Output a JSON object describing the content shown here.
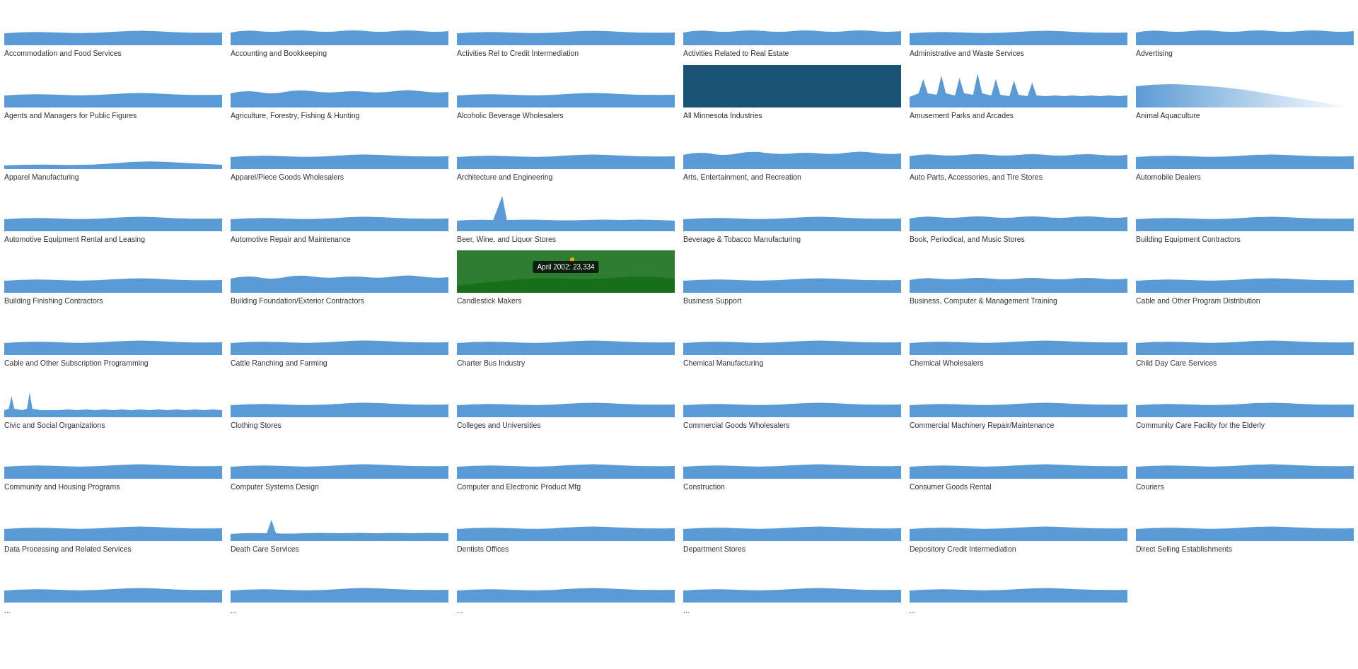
{
  "cells": [
    {
      "id": "c1",
      "label": "Accommodation and Food Services",
      "type": "wave_flat"
    },
    {
      "id": "c2",
      "label": "Accounting and Bookkeeping",
      "type": "wave_small"
    },
    {
      "id": "c3",
      "label": "Activities Rel to Credit Intermediation",
      "type": "wave_flat"
    },
    {
      "id": "c4",
      "label": "Activities Related to Real Estate",
      "type": "wave_small"
    },
    {
      "id": "c5",
      "label": "Administrative and Waste Services",
      "type": "wave_flat"
    },
    {
      "id": "c6",
      "label": "Advertising",
      "type": "wave_small"
    },
    {
      "id": "c7",
      "label": "Agents and Managers for Public Figures",
      "type": "wave_flat"
    },
    {
      "id": "c8",
      "label": "Agriculture, Forestry, Fishing & Hunting",
      "type": "wave_medium"
    },
    {
      "id": "c9",
      "label": "Alcoholic Beverage Wholesalers",
      "type": "wave_flat"
    },
    {
      "id": "c10",
      "label": "All Minnesota Industries",
      "type": "filled_dark"
    },
    {
      "id": "c11",
      "label": "Amusement Parks and Arcades",
      "type": "wave_spiky"
    },
    {
      "id": "c12",
      "label": "Animal Aquaculture",
      "type": "fade_right"
    },
    {
      "id": "c13",
      "label": "Apparel Manufacturing",
      "type": "wave_low"
    },
    {
      "id": "c14",
      "label": "Apparel/Piece Goods Wholesalers",
      "type": "wave_flat"
    },
    {
      "id": "c15",
      "label": "Architecture and Engineering",
      "type": "wave_flat"
    },
    {
      "id": "c16",
      "label": "Arts, Entertainment, and Recreation",
      "type": "wave_medium"
    },
    {
      "id": "c17",
      "label": "Auto Parts, Accessories, and Tire Stores",
      "type": "wave_small"
    },
    {
      "id": "c18",
      "label": "Automobile Dealers",
      "type": "wave_flat"
    },
    {
      "id": "c19",
      "label": "Automotive Equipment Rental and Leasing",
      "type": "wave_flat"
    },
    {
      "id": "c20",
      "label": "Automotive Repair and Maintenance",
      "type": "wave_flat"
    },
    {
      "id": "c21",
      "label": "Beer, Wine, and Liquor Stores",
      "type": "drop_spike",
      "highlighted": false
    },
    {
      "id": "c22",
      "label": "Beverage & Tobacco Manufacturing",
      "type": "wave_flat"
    },
    {
      "id": "c23",
      "label": "Book, Periodical, and Music Stores",
      "type": "wave_small"
    },
    {
      "id": "c24",
      "label": "Building Equipment Contractors",
      "type": "wave_flat"
    },
    {
      "id": "c25",
      "label": "Building Finishing Contractors",
      "type": "wave_flat"
    },
    {
      "id": "c26",
      "label": "Building Foundation/Exterior Contractors",
      "type": "wave_medium"
    },
    {
      "id": "c27",
      "label": "Candlestick Makers",
      "type": "green_highlighted",
      "tooltip": "April 2002: 23,334"
    },
    {
      "id": "c28",
      "label": "Business Support",
      "type": "wave_flat"
    },
    {
      "id": "c29",
      "label": "Business, Computer & Management Training",
      "type": "wave_small"
    },
    {
      "id": "c30",
      "label": "Cable and Other Program Distribution",
      "type": "wave_flat"
    },
    {
      "id": "c31",
      "label": "Cable and Other Subscription Programming",
      "type": "wave_flat"
    },
    {
      "id": "c32",
      "label": "Cattle Ranching and Farming",
      "type": "wave_flat"
    },
    {
      "id": "c33",
      "label": "Charter Bus Industry",
      "type": "wave_flat"
    },
    {
      "id": "c34",
      "label": "Chemical Manufacturing",
      "type": "wave_flat"
    },
    {
      "id": "c35",
      "label": "Chemical Wholesalers",
      "type": "wave_flat"
    },
    {
      "id": "c36",
      "label": "Child Day Care Services",
      "type": "wave_flat"
    },
    {
      "id": "c37",
      "label": "Civic and Social Organizations",
      "type": "wave_spiky2"
    },
    {
      "id": "c38",
      "label": "Clothing Stores",
      "type": "wave_flat"
    },
    {
      "id": "c39",
      "label": "Colleges and Universities",
      "type": "wave_flat"
    },
    {
      "id": "c40",
      "label": "Commercial Goods Wholesalers",
      "type": "wave_flat"
    },
    {
      "id": "c41",
      "label": "Commercial Machinery Repair/Maintenance",
      "type": "wave_flat"
    },
    {
      "id": "c42",
      "label": "Community Care Facility for the Elderly",
      "type": "wave_flat"
    },
    {
      "id": "c43",
      "label": "Community and Housing Programs",
      "type": "wave_flat"
    },
    {
      "id": "c44",
      "label": "Computer Systems Design",
      "type": "wave_flat"
    },
    {
      "id": "c45",
      "label": "Computer and Electronic Product Mfg",
      "type": "wave_flat"
    },
    {
      "id": "c46",
      "label": "Construction",
      "type": "wave_flat"
    },
    {
      "id": "c47",
      "label": "Consumer Goods Rental",
      "type": "wave_flat"
    },
    {
      "id": "c48",
      "label": "Couriers",
      "type": "wave_flat"
    },
    {
      "id": "c49",
      "label": "Data Processing and Related Services",
      "type": "wave_flat"
    },
    {
      "id": "c50",
      "label": "Death Care Services",
      "type": "wave_spike_single"
    },
    {
      "id": "c51",
      "label": "Dentists Offices",
      "type": "wave_flat"
    },
    {
      "id": "c52",
      "label": "Department Stores",
      "type": "wave_flat"
    },
    {
      "id": "c53",
      "label": "Depository Credit Intermediation",
      "type": "wave_flat"
    },
    {
      "id": "c54",
      "label": "Direct Selling Establishments",
      "type": "wave_flat"
    },
    {
      "id": "c55",
      "label": "...",
      "type": "wave_flat"
    },
    {
      "id": "c56",
      "label": "...",
      "type": "wave_flat"
    },
    {
      "id": "c57",
      "label": "...",
      "type": "wave_flat"
    },
    {
      "id": "c58",
      "label": "...",
      "type": "wave_flat"
    },
    {
      "id": "c59",
      "label": "...",
      "type": "wave_flat"
    },
    {
      "id": "c60",
      "label": "",
      "type": "empty"
    }
  ],
  "colors": {
    "chart_fill": "#5b9bd5",
    "chart_stroke": "#5b9bd5",
    "dark_fill": "#1a5276",
    "green_fill": "#2e7d32",
    "tooltip_bg": "rgba(0,0,0,0.75)",
    "tooltip_text": "#ffffff"
  }
}
